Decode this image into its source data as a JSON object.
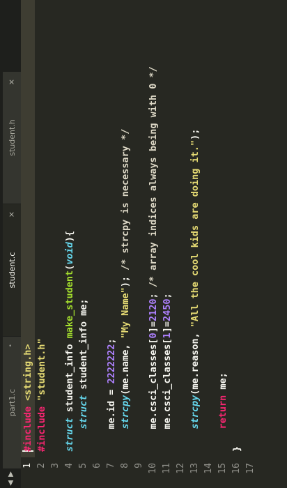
{
  "tabs": [
    {
      "label": "part1.c",
      "button": "•",
      "active": false
    },
    {
      "label": "student.c",
      "button": "×",
      "active": true
    },
    {
      "label": "student.h",
      "button": "×",
      "active": false
    }
  ],
  "nav_arrows": "◀ ▶",
  "line_numbers": [
    "1",
    "2",
    "3",
    "4",
    "5",
    "6",
    "7",
    "8",
    "9",
    "10",
    "11",
    "12",
    "13",
    "14",
    "15",
    "16",
    "17"
  ],
  "code": {
    "l1": [
      "#include",
      " ",
      "<string.h>"
    ],
    "l2": [
      "#include",
      " ",
      "\"student.h\""
    ],
    "l3": [
      ""
    ],
    "l4": [
      "struct",
      " student_info ",
      "make_student",
      "(",
      "void",
      "){"
    ],
    "l5": [
      "    ",
      "struct",
      " student_info me;"
    ],
    "l6": [
      ""
    ],
    "l7": [
      "    me.id = ",
      "2222222",
      ";"
    ],
    "l8": [
      "    ",
      "strcpy",
      "(me.name, ",
      "\"My Name\"",
      "); ",
      "/* strcpy is necessary */"
    ],
    "l9": [
      ""
    ],
    "l10": [
      "    me.csci_classes[",
      "0",
      "]=",
      "2120",
      "; ",
      "/* array indices always being with 0 */"
    ],
    "l11": [
      "    me.csci_classes[",
      "1",
      "]=",
      "2450",
      ";"
    ],
    "l12": [
      ""
    ],
    "l13": [
      "    ",
      "strcpy",
      "(me.reason, ",
      "\"All the cool kids are doing it.\"",
      ");"
    ],
    "l14": [
      ""
    ],
    "l15": [
      "    ",
      "return",
      " me;"
    ],
    "l16": [
      "}"
    ],
    "l17": [
      ""
    ]
  }
}
